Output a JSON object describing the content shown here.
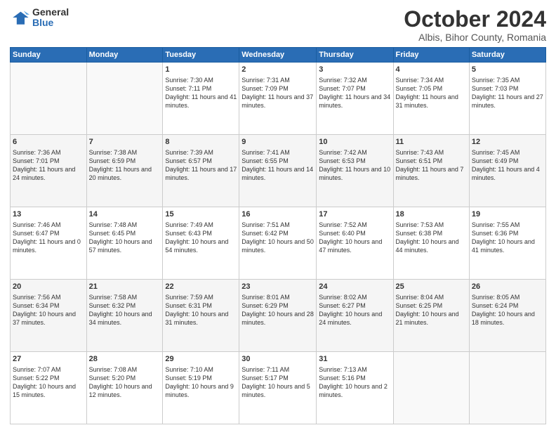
{
  "header": {
    "logo_general": "General",
    "logo_blue": "Blue",
    "month_title": "October 2024",
    "location": "Albis, Bihor County, Romania"
  },
  "days_of_week": [
    "Sunday",
    "Monday",
    "Tuesday",
    "Wednesday",
    "Thursday",
    "Friday",
    "Saturday"
  ],
  "weeks": [
    [
      {
        "day": "",
        "sunrise": "",
        "sunset": "",
        "daylight": ""
      },
      {
        "day": "",
        "sunrise": "",
        "sunset": "",
        "daylight": ""
      },
      {
        "day": "1",
        "sunrise": "Sunrise: 7:30 AM",
        "sunset": "Sunset: 7:11 PM",
        "daylight": "Daylight: 11 hours and 41 minutes."
      },
      {
        "day": "2",
        "sunrise": "Sunrise: 7:31 AM",
        "sunset": "Sunset: 7:09 PM",
        "daylight": "Daylight: 11 hours and 37 minutes."
      },
      {
        "day": "3",
        "sunrise": "Sunrise: 7:32 AM",
        "sunset": "Sunset: 7:07 PM",
        "daylight": "Daylight: 11 hours and 34 minutes."
      },
      {
        "day": "4",
        "sunrise": "Sunrise: 7:34 AM",
        "sunset": "Sunset: 7:05 PM",
        "daylight": "Daylight: 11 hours and 31 minutes."
      },
      {
        "day": "5",
        "sunrise": "Sunrise: 7:35 AM",
        "sunset": "Sunset: 7:03 PM",
        "daylight": "Daylight: 11 hours and 27 minutes."
      }
    ],
    [
      {
        "day": "6",
        "sunrise": "Sunrise: 7:36 AM",
        "sunset": "Sunset: 7:01 PM",
        "daylight": "Daylight: 11 hours and 24 minutes."
      },
      {
        "day": "7",
        "sunrise": "Sunrise: 7:38 AM",
        "sunset": "Sunset: 6:59 PM",
        "daylight": "Daylight: 11 hours and 20 minutes."
      },
      {
        "day": "8",
        "sunrise": "Sunrise: 7:39 AM",
        "sunset": "Sunset: 6:57 PM",
        "daylight": "Daylight: 11 hours and 17 minutes."
      },
      {
        "day": "9",
        "sunrise": "Sunrise: 7:41 AM",
        "sunset": "Sunset: 6:55 PM",
        "daylight": "Daylight: 11 hours and 14 minutes."
      },
      {
        "day": "10",
        "sunrise": "Sunrise: 7:42 AM",
        "sunset": "Sunset: 6:53 PM",
        "daylight": "Daylight: 11 hours and 10 minutes."
      },
      {
        "day": "11",
        "sunrise": "Sunrise: 7:43 AM",
        "sunset": "Sunset: 6:51 PM",
        "daylight": "Daylight: 11 hours and 7 minutes."
      },
      {
        "day": "12",
        "sunrise": "Sunrise: 7:45 AM",
        "sunset": "Sunset: 6:49 PM",
        "daylight": "Daylight: 11 hours and 4 minutes."
      }
    ],
    [
      {
        "day": "13",
        "sunrise": "Sunrise: 7:46 AM",
        "sunset": "Sunset: 6:47 PM",
        "daylight": "Daylight: 11 hours and 0 minutes."
      },
      {
        "day": "14",
        "sunrise": "Sunrise: 7:48 AM",
        "sunset": "Sunset: 6:45 PM",
        "daylight": "Daylight: 10 hours and 57 minutes."
      },
      {
        "day": "15",
        "sunrise": "Sunrise: 7:49 AM",
        "sunset": "Sunset: 6:43 PM",
        "daylight": "Daylight: 10 hours and 54 minutes."
      },
      {
        "day": "16",
        "sunrise": "Sunrise: 7:51 AM",
        "sunset": "Sunset: 6:42 PM",
        "daylight": "Daylight: 10 hours and 50 minutes."
      },
      {
        "day": "17",
        "sunrise": "Sunrise: 7:52 AM",
        "sunset": "Sunset: 6:40 PM",
        "daylight": "Daylight: 10 hours and 47 minutes."
      },
      {
        "day": "18",
        "sunrise": "Sunrise: 7:53 AM",
        "sunset": "Sunset: 6:38 PM",
        "daylight": "Daylight: 10 hours and 44 minutes."
      },
      {
        "day": "19",
        "sunrise": "Sunrise: 7:55 AM",
        "sunset": "Sunset: 6:36 PM",
        "daylight": "Daylight: 10 hours and 41 minutes."
      }
    ],
    [
      {
        "day": "20",
        "sunrise": "Sunrise: 7:56 AM",
        "sunset": "Sunset: 6:34 PM",
        "daylight": "Daylight: 10 hours and 37 minutes."
      },
      {
        "day": "21",
        "sunrise": "Sunrise: 7:58 AM",
        "sunset": "Sunset: 6:32 PM",
        "daylight": "Daylight: 10 hours and 34 minutes."
      },
      {
        "day": "22",
        "sunrise": "Sunrise: 7:59 AM",
        "sunset": "Sunset: 6:31 PM",
        "daylight": "Daylight: 10 hours and 31 minutes."
      },
      {
        "day": "23",
        "sunrise": "Sunrise: 8:01 AM",
        "sunset": "Sunset: 6:29 PM",
        "daylight": "Daylight: 10 hours and 28 minutes."
      },
      {
        "day": "24",
        "sunrise": "Sunrise: 8:02 AM",
        "sunset": "Sunset: 6:27 PM",
        "daylight": "Daylight: 10 hours and 24 minutes."
      },
      {
        "day": "25",
        "sunrise": "Sunrise: 8:04 AM",
        "sunset": "Sunset: 6:25 PM",
        "daylight": "Daylight: 10 hours and 21 minutes."
      },
      {
        "day": "26",
        "sunrise": "Sunrise: 8:05 AM",
        "sunset": "Sunset: 6:24 PM",
        "daylight": "Daylight: 10 hours and 18 minutes."
      }
    ],
    [
      {
        "day": "27",
        "sunrise": "Sunrise: 7:07 AM",
        "sunset": "Sunset: 5:22 PM",
        "daylight": "Daylight: 10 hours and 15 minutes."
      },
      {
        "day": "28",
        "sunrise": "Sunrise: 7:08 AM",
        "sunset": "Sunset: 5:20 PM",
        "daylight": "Daylight: 10 hours and 12 minutes."
      },
      {
        "day": "29",
        "sunrise": "Sunrise: 7:10 AM",
        "sunset": "Sunset: 5:19 PM",
        "daylight": "Daylight: 10 hours and 9 minutes."
      },
      {
        "day": "30",
        "sunrise": "Sunrise: 7:11 AM",
        "sunset": "Sunset: 5:17 PM",
        "daylight": "Daylight: 10 hours and 5 minutes."
      },
      {
        "day": "31",
        "sunrise": "Sunrise: 7:13 AM",
        "sunset": "Sunset: 5:16 PM",
        "daylight": "Daylight: 10 hours and 2 minutes."
      },
      {
        "day": "",
        "sunrise": "",
        "sunset": "",
        "daylight": ""
      },
      {
        "day": "",
        "sunrise": "",
        "sunset": "",
        "daylight": ""
      }
    ]
  ]
}
